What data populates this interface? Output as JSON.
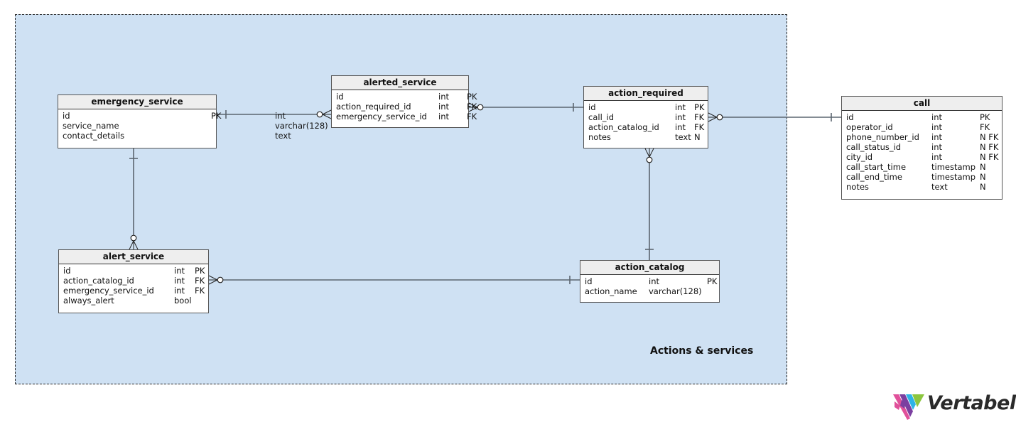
{
  "area": {
    "label": "Actions & services",
    "fill": "#cfe1f3"
  },
  "tables": {
    "emergency_service": {
      "name": "emergency_service",
      "columns": [
        {
          "name": "id",
          "type": "int",
          "flags": "PK"
        },
        {
          "name": "service_name",
          "type": "varchar(128)",
          "flags": ""
        },
        {
          "name": "contact_details",
          "type": "text",
          "flags": ""
        }
      ]
    },
    "alerted_service": {
      "name": "alerted_service",
      "columns": [
        {
          "name": "id",
          "type": "int",
          "flags": "PK"
        },
        {
          "name": "action_required_id",
          "type": "int",
          "flags": "FK"
        },
        {
          "name": "emergency_service_id",
          "type": "int",
          "flags": "FK"
        }
      ]
    },
    "action_required": {
      "name": "action_required",
      "columns": [
        {
          "name": "id",
          "type": "int",
          "flags": "PK"
        },
        {
          "name": "call_id",
          "type": "int",
          "flags": "FK"
        },
        {
          "name": "action_catalog_id",
          "type": "int",
          "flags": "FK"
        },
        {
          "name": "notes",
          "type": "text",
          "flags": "N"
        }
      ]
    },
    "call": {
      "name": "call",
      "columns": [
        {
          "name": "id",
          "type": "int",
          "flags": "PK"
        },
        {
          "name": "operator_id",
          "type": "int",
          "flags": "FK"
        },
        {
          "name": "phone_number_id",
          "type": "int",
          "flags": "N FK"
        },
        {
          "name": "call_status_id",
          "type": "int",
          "flags": "N FK"
        },
        {
          "name": "city_id",
          "type": "int",
          "flags": "N FK"
        },
        {
          "name": "call_start_time",
          "type": "timestamp",
          "flags": "N"
        },
        {
          "name": "call_end_time",
          "type": "timestamp",
          "flags": "N"
        },
        {
          "name": "notes",
          "type": "text",
          "flags": "N"
        }
      ]
    },
    "alert_service": {
      "name": "alert_service",
      "columns": [
        {
          "name": "id",
          "type": "int",
          "flags": "PK"
        },
        {
          "name": "action_catalog_id",
          "type": "int",
          "flags": "FK"
        },
        {
          "name": "emergency_service_id",
          "type": "int",
          "flags": "FK"
        },
        {
          "name": "always_alert",
          "type": "bool",
          "flags": ""
        }
      ]
    },
    "action_catalog": {
      "name": "action_catalog",
      "columns": [
        {
          "name": "id",
          "type": "int",
          "flags": "PK"
        },
        {
          "name": "action_name",
          "type": "varchar(128)",
          "flags": ""
        }
      ]
    }
  },
  "relationships": [
    {
      "from": "emergency_service",
      "to": "alerted_service",
      "from_card": "one",
      "to_card": "zero-or-many"
    },
    {
      "from": "action_required",
      "to": "alerted_service",
      "from_card": "one",
      "to_card": "zero-or-many"
    },
    {
      "from": "call",
      "to": "action_required",
      "from_card": "one",
      "to_card": "zero-or-many"
    },
    {
      "from": "action_catalog",
      "to": "action_required",
      "from_card": "one",
      "to_card": "zero-or-many"
    },
    {
      "from": "emergency_service",
      "to": "alert_service",
      "from_card": "one",
      "to_card": "zero-or-many"
    },
    {
      "from": "action_catalog",
      "to": "alert_service",
      "from_card": "one",
      "to_card": "zero-or-many"
    }
  ],
  "logo": {
    "text": "Vertabelo",
    "colors": [
      "#e0509a",
      "#7b3fa0",
      "#2eb4e6",
      "#8cc63f"
    ]
  }
}
